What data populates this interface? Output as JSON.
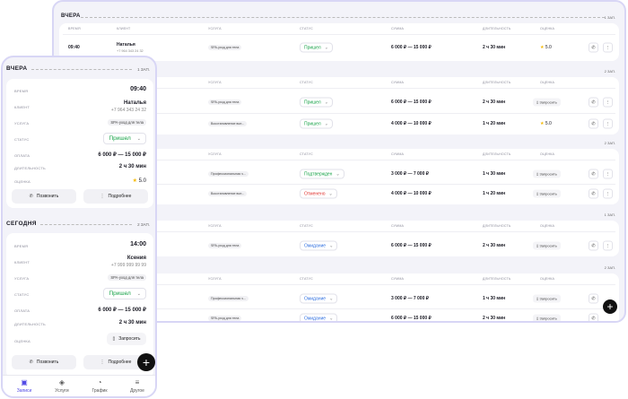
{
  "desktop": {
    "columns": {
      "time": "ВРЕМЯ",
      "client": "КЛИЕНТ",
      "service": "УСЛУГА",
      "status": "СТАТУС",
      "amount": "СУММА",
      "duration": "ДЛИТЕЛЬНОСТЬ",
      "rating": "ОЦЕНКА"
    },
    "yesterday": {
      "title": "ВЧЕРА",
      "count": "1 ЗАП."
    },
    "row1": {
      "time": "09:40",
      "client": "Наталья",
      "phone": "+7 964 343 24 32",
      "service": "SPA-уход для тела",
      "status": "Пришел",
      "amount": "6 000 ₽ — 15 000 ₽",
      "duration": "2 ч 30 мин",
      "rating": "5.0"
    },
    "g2": {
      "count": "2 ЗАП."
    },
    "row2": {
      "service": "SPA-уход для тела",
      "status": "Пришел",
      "amount": "6 000 ₽ — 15 000 ₽",
      "duration": "2 ч 30 мин",
      "request": "Запросить"
    },
    "row3": {
      "service": "Восстановление вол...",
      "status": "Пришел",
      "amount": "4 000 ₽ — 10 000 ₽",
      "duration": "1 ч 20 мин",
      "rating": "5.0"
    },
    "g3": {
      "count": "2 ЗАП."
    },
    "row4": {
      "service": "Профессиональная ч...",
      "status": "Подтвержден",
      "amount": "3 000 ₽ — 7 000 ₽",
      "duration": "1 ч 30 мин",
      "request": "Запросить"
    },
    "row5": {
      "service": "Восстановление вол...",
      "status": "Отменено",
      "amount": "4 000 ₽ — 10 000 ₽",
      "duration": "1 ч 20 мин",
      "request": "Запросить"
    },
    "g4": {
      "count": "1 ЗАП."
    },
    "row6": {
      "service": "SPA-уход для тела",
      "status": "Ожидание",
      "amount": "6 000 ₽ — 15 000 ₽",
      "duration": "2 ч 30 мин",
      "request": "Запросить"
    },
    "g5": {
      "count": "2 ЗАП."
    },
    "row7": {
      "service": "Профессиональная ч...",
      "status": "Ожидание",
      "amount": "3 000 ₽ — 7 000 ₽",
      "duration": "1 ч 30 мин",
      "request": "Запросить"
    },
    "row8": {
      "service": "SPA-уход для тела",
      "status": "Ожидание",
      "amount": "6 000 ₽ — 15 000 ₽",
      "duration": "2 ч 30 мин",
      "request": "Запросить"
    }
  },
  "mobile": {
    "labels": {
      "time": "ВРЕМЯ",
      "client": "КЛИЕНТ",
      "service": "УСЛУГА",
      "status": "СТАТУС",
      "payment": "ОПЛАТА",
      "duration": "ДЛИТЕЛЬНОСТЬ",
      "rating": "ОЦЕНКА"
    },
    "yesterday": {
      "title": "ВЧЕРА",
      "count": "1 ЗАП.",
      "time": "09:40",
      "client": "Наталья",
      "phone": "+7 964 343 24 32",
      "service": "SPA-уход для тела",
      "status": "Пришел",
      "payment": "6 000 ₽ — 15 000 ₽",
      "duration": "2 ч 30 мин",
      "rating": "5.0"
    },
    "today": {
      "title": "СЕГОДНЯ",
      "count": "2 ЗАП.",
      "time": "14:00",
      "client": "Ксения",
      "phone": "+7 999 999 99 99",
      "service": "SPA-уход для тела",
      "status": "Пришел",
      "payment": "6 000 ₽ — 15 000 ₽",
      "duration": "2 ч 30 мин",
      "request": "Запросить"
    },
    "buttons": {
      "call": "Позвонить",
      "more": "Подробнее"
    },
    "tabs": [
      "Записи",
      "Услуги",
      "График",
      "Другое"
    ]
  },
  "colors": {
    "accent": "#5048e5",
    "green": "#1aa34a",
    "red": "#e0322e",
    "blue": "#2f6fe0",
    "star": "#f5b800"
  }
}
